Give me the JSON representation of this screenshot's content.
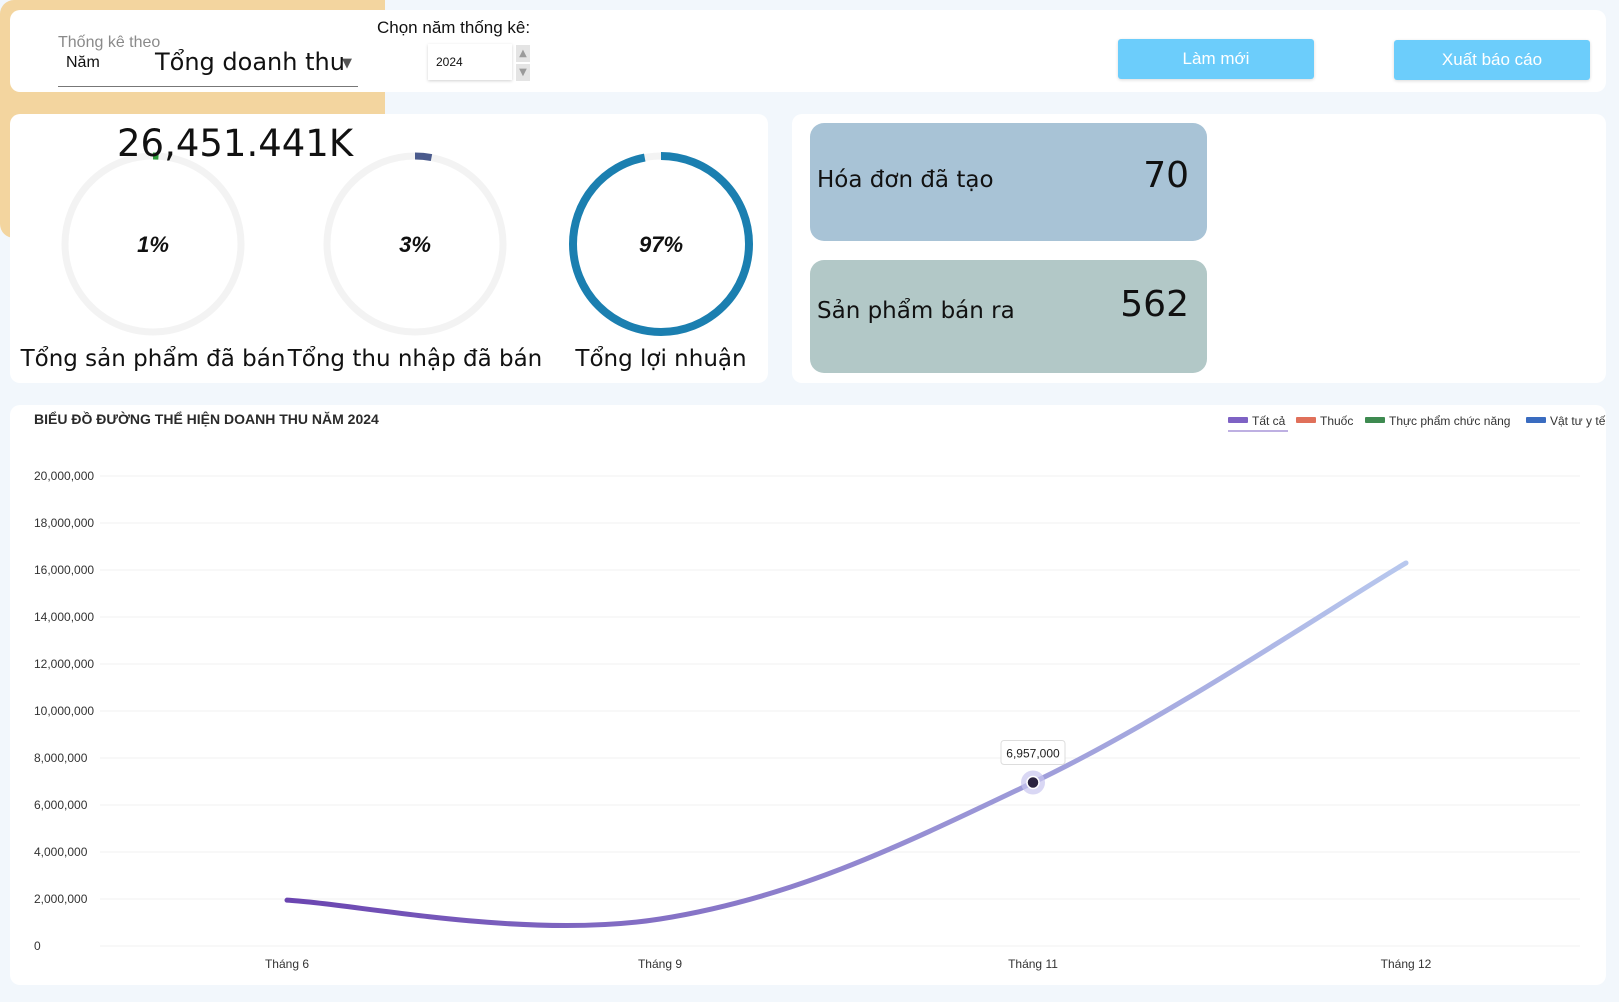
{
  "filters": {
    "period_label": "Thống kê theo",
    "period_value": "Năm",
    "year_label": "Chọn năm thống kê:",
    "year_value": "2024"
  },
  "buttons": {
    "refresh": "Làm mới",
    "export": "Xuất báo cáo"
  },
  "gauges": [
    {
      "percent_text": "1%",
      "percent": 1,
      "label": "Tổng sản phẩm đã bán",
      "color": "#2e9e3a"
    },
    {
      "percent_text": "3%",
      "percent": 3,
      "label": "Tổng thu nhập đã bán",
      "color": "#4a5a8c"
    },
    {
      "percent_text": "97%",
      "percent": 97,
      "label": "Tổng lợi nhuận",
      "color": "#1b7fb0"
    }
  ],
  "stats": {
    "invoices_label": "Hóa đơn đã tạo",
    "invoices_value": "70",
    "products_label": "Sản phẩm bán ra",
    "products_value": "562",
    "revenue_label": "Tổng doanh thu",
    "revenue_value": "26,451.441K"
  },
  "colors": {
    "button": "#6ccdfb",
    "invoices_card": "#a8c3d6",
    "products_card": "#b2c8c7",
    "revenue_card": "#f3d59f"
  },
  "chart_data": {
    "type": "line",
    "title": "BIỂU ĐỒ ĐƯỜNG THỂ HIỆN DOANH THU NĂM 2024",
    "categories": [
      "Tháng 6",
      "Tháng 9",
      "Tháng 11",
      "Tháng 12"
    ],
    "series": [
      {
        "name": "Tất cả",
        "values": [
          1950000,
          1150000,
          6957000,
          16300000
        ],
        "color": "#6a44b0",
        "color_end": "#b8c8ee"
      }
    ],
    "legend": [
      {
        "name": "Tất cả",
        "color": "#7e62c4"
      },
      {
        "name": "Thuốc",
        "color": "#e0705a"
      },
      {
        "name": "Thực phẩm chức năng",
        "color": "#3e8a50"
      },
      {
        "name": "Vật tư y tế",
        "color": "#3a6cc0"
      }
    ],
    "legend_position": "top-right",
    "ylim": [
      0,
      20000000
    ],
    "yticks": [
      "20,000,000",
      "18,000,000",
      "16,000,000",
      "14,000,000",
      "12,000,000",
      "10,000,000",
      "8,000,000",
      "6,000,000",
      "4,000,000",
      "2,000,000",
      "0"
    ],
    "tooltip": {
      "category": "Tháng 11",
      "value_text": "6,957,000"
    },
    "grid": true
  }
}
